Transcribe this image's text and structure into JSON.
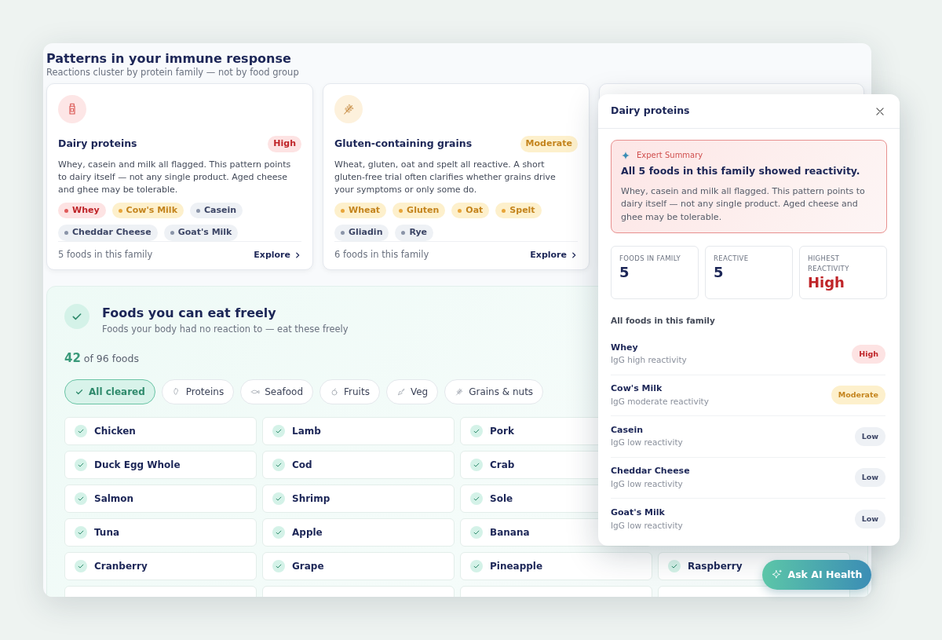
{
  "patterns": {
    "title": "Patterns in your immune response",
    "subtitle": "Reactions cluster by protein family — not by food group",
    "families": [
      {
        "kind": "dairy",
        "name": "Dairy proteins",
        "color": "#bf2428",
        "level_label": "High",
        "description": "Whey, casein and milk all flagged. This pattern points to dairy itself — not any single product. Aged cheese and ghee may be tolerable.",
        "foods": [
          {
            "name": "Whey",
            "color": "#e05a5a"
          },
          {
            "name": "Cow's Milk",
            "color": "#e8a53a"
          },
          {
            "name": "Casein",
            "color": "#8a94a8"
          },
          {
            "name": "Cheddar Cheese",
            "color": "#8a94a8"
          },
          {
            "name": "Goat's Milk",
            "color": "#8a94a8"
          }
        ],
        "count": "5 foods in this family",
        "action": "Explore"
      },
      {
        "kind": "grain",
        "name": "Gluten-containing grains",
        "color": "#c4841d",
        "level_label": "Moderate",
        "description": "Wheat, gluten, oat and spelt all reactive. A short gluten-free trial often clarifies whether grains drive your symptoms or only some do.",
        "foods": [
          {
            "name": "Wheat",
            "color": "#e8a53a"
          },
          {
            "name": "Gluten",
            "color": "#e8a53a"
          },
          {
            "name": "Oat",
            "color": "#e8a53a"
          },
          {
            "name": "Spelt",
            "color": "#e8a53a"
          },
          {
            "name": "Gliadin",
            "color": "#8a94a8"
          },
          {
            "name": "Rye",
            "color": "#8a94a8"
          }
        ],
        "count": "6 foods in this family",
        "action": "Explore"
      },
      {
        "kind": "hidden"
      }
    ]
  },
  "cleared": {
    "title": "Foods you can eat freely",
    "subtitle": "Foods your body had no reaction to — eat these freely",
    "count": "42",
    "count_suffix": "of 96 foods",
    "filters": [
      {
        "label": "All cleared",
        "kind": "check",
        "selected": true
      },
      {
        "label": "Proteins",
        "kind": "protein",
        "selected": false
      },
      {
        "label": "Seafood",
        "kind": "fish",
        "selected": false
      },
      {
        "label": "Fruits",
        "kind": "fruit",
        "selected": false
      },
      {
        "label": "Veg",
        "kind": "veg",
        "selected": false
      },
      {
        "label": "Grains & nuts",
        "kind": "grain",
        "selected": false
      }
    ],
    "rows": [
      [
        "Chicken",
        "Lamb",
        "Pork"
      ],
      [
        "Duck Egg Whole",
        "Cod",
        "Crab"
      ],
      [
        "Salmon",
        "Shrimp",
        "Sole"
      ],
      [
        "Tuna",
        "Apple",
        "Banana"
      ],
      [
        "Cranberry",
        "Grape",
        "Pineapple",
        "Raspberry"
      ]
    ]
  },
  "popover": {
    "title": "Dairy proteins",
    "summary_label": "Expert Summary",
    "summary_title": "All 5 foods in this family showed reactivity.",
    "summary_text": "Whey, casein and milk all flagged. This pattern points to dairy itself — not any single product. Aged cheese and ghee may be tolerable.",
    "stats": [
      {
        "label": "FOODS IN FAMILY",
        "value": "5",
        "color": "#1c2657"
      },
      {
        "label": "REACTIVE",
        "value": "5",
        "color": "#1c2657"
      },
      {
        "label": "HIGHEST REACTIVITY",
        "value": "High",
        "color": "#bf2428"
      }
    ],
    "list_title": "All foods in this family",
    "foods": [
      {
        "name": "Whey",
        "detail": "IgG high reactivity",
        "color": "#bf2428",
        "level_label": "High"
      },
      {
        "name": "Cow's Milk",
        "detail": "IgG moderate reactivity",
        "color": "#c4841d",
        "level_label": "Moderate"
      },
      {
        "name": "Casein",
        "detail": "IgG low reactivity",
        "color": "#3d4666",
        "level_label": "Low"
      },
      {
        "name": "Cheddar Cheese",
        "detail": "IgG low reactivity",
        "color": "#3d4666",
        "level_label": "Low"
      },
      {
        "name": "Goat's Milk",
        "detail": "IgG low reactivity",
        "color": "#3d4666",
        "level_label": "Low"
      }
    ]
  },
  "assistant_button": "Ask AI Health"
}
